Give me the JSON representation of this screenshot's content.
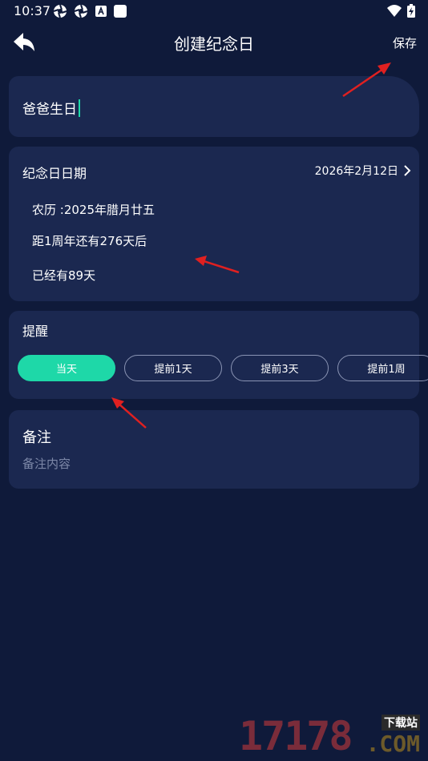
{
  "status_bar": {
    "time": "10:37"
  },
  "header": {
    "title": "创建纪念日",
    "save_label": "保存"
  },
  "name_field": {
    "value": "爸爸生日"
  },
  "date_section": {
    "label": "纪念日日期",
    "date_value": "2026年2月12日",
    "lunar": "农历 :2025年腊月廿五",
    "anniversary": "距1周年还有276天后",
    "elapsed": "已经有89天"
  },
  "reminder": {
    "label": "提醒",
    "options": [
      "当天",
      "提前1天",
      "提前3天",
      "提前1周"
    ],
    "selected": "当天"
  },
  "notes": {
    "label": "备注",
    "placeholder": "备注内容"
  },
  "watermark": {
    "number": "17178",
    "top": "下载站",
    "domain": ".COM"
  },
  "colors": {
    "background": "#0f1a3a",
    "card": "#1b2850",
    "accent": "#1ed8a8",
    "annotation_arrow": "#e02020"
  }
}
